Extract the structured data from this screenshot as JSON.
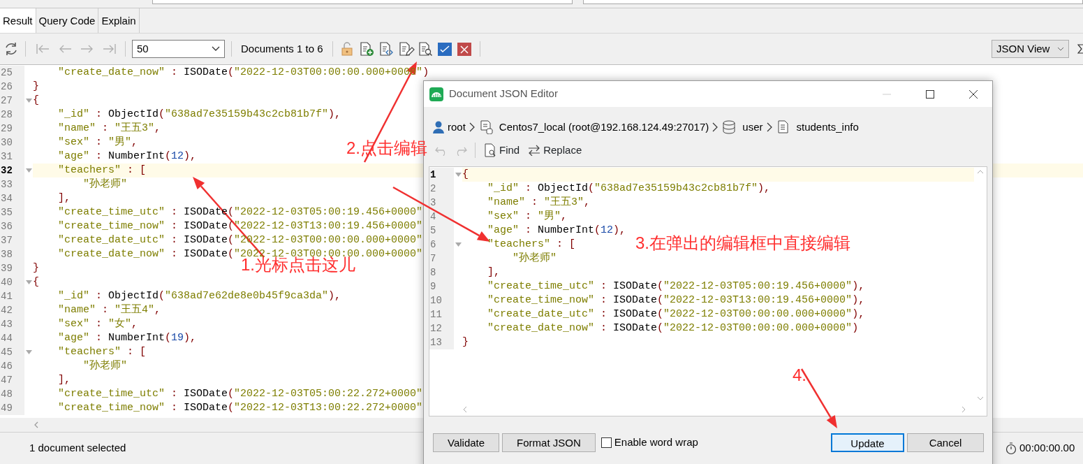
{
  "tabs": [
    {
      "label": "Result",
      "selected": true
    },
    {
      "label": "Query Code",
      "selected": false
    },
    {
      "label": "Explain",
      "selected": false
    }
  ],
  "toolbar": {
    "navigation_disabled": true,
    "page_size": "50",
    "documents_label": "Documents 1 to 6",
    "view_mode": "JSON View"
  },
  "editor": {
    "lines": [
      {
        "no": "25",
        "fold": false,
        "current": false,
        "tokens": [
          {
            "kind": "key",
            "text": "    \"create_date_now\""
          },
          {
            "kind": "punct",
            "text": " : "
          },
          {
            "kind": "func",
            "text": "ISODate"
          },
          {
            "kind": "punct",
            "text": "("
          },
          {
            "kind": "str",
            "text": "\"2022-12-03T00:00:00.000+0000\""
          },
          {
            "kind": "punct",
            "text": ")"
          }
        ]
      },
      {
        "no": "26",
        "fold": false,
        "current": false,
        "tokens": [
          {
            "kind": "punct",
            "text": "}"
          }
        ]
      },
      {
        "no": "27",
        "fold": true,
        "current": false,
        "tokens": [
          {
            "kind": "punct",
            "text": "{"
          }
        ]
      },
      {
        "no": "28",
        "fold": false,
        "current": false,
        "tokens": [
          {
            "kind": "key",
            "text": "    \"_id\""
          },
          {
            "kind": "punct",
            "text": " : "
          },
          {
            "kind": "func",
            "text": "ObjectId"
          },
          {
            "kind": "punct",
            "text": "("
          },
          {
            "kind": "str",
            "text": "\"638ad7e35159b43c2cb81b7f\""
          },
          {
            "kind": "punct",
            "text": "),"
          }
        ]
      },
      {
        "no": "29",
        "fold": false,
        "current": false,
        "tokens": [
          {
            "kind": "key",
            "text": "    \"name\""
          },
          {
            "kind": "punct",
            "text": " : "
          },
          {
            "kind": "str",
            "text": "\"王五3\""
          },
          {
            "kind": "punct",
            "text": ","
          }
        ]
      },
      {
        "no": "30",
        "fold": false,
        "current": false,
        "tokens": [
          {
            "kind": "key",
            "text": "    \"sex\""
          },
          {
            "kind": "punct",
            "text": " : "
          },
          {
            "kind": "str",
            "text": "\"男\""
          },
          {
            "kind": "punct",
            "text": ","
          }
        ]
      },
      {
        "no": "31",
        "fold": false,
        "current": false,
        "tokens": [
          {
            "kind": "key",
            "text": "    \"age\""
          },
          {
            "kind": "punct",
            "text": " : "
          },
          {
            "kind": "func",
            "text": "NumberInt"
          },
          {
            "kind": "punct",
            "text": "("
          },
          {
            "kind": "num",
            "text": "12"
          },
          {
            "kind": "punct",
            "text": "),"
          }
        ]
      },
      {
        "no": "32",
        "fold": true,
        "current": true,
        "tokens": [
          {
            "kind": "key",
            "text": "    \"teachers\""
          },
          {
            "kind": "punct",
            "text": " : ["
          }
        ]
      },
      {
        "no": "33",
        "fold": false,
        "current": false,
        "tokens": [
          {
            "kind": "str",
            "text": "        \"孙老师\""
          }
        ]
      },
      {
        "no": "34",
        "fold": false,
        "current": false,
        "tokens": [
          {
            "kind": "punct",
            "text": "    ],"
          }
        ]
      },
      {
        "no": "35",
        "fold": false,
        "current": false,
        "tokens": [
          {
            "kind": "key",
            "text": "    \"create_time_utc\""
          },
          {
            "kind": "punct",
            "text": " : "
          },
          {
            "kind": "func",
            "text": "ISODate"
          },
          {
            "kind": "punct",
            "text": "("
          },
          {
            "kind": "str",
            "text": "\"2022-12-03T05:00:19.456+0000\""
          }
        ]
      },
      {
        "no": "36",
        "fold": false,
        "current": false,
        "tokens": [
          {
            "kind": "key",
            "text": "    \"create_time_now\""
          },
          {
            "kind": "punct",
            "text": " : "
          },
          {
            "kind": "func",
            "text": "ISODate"
          },
          {
            "kind": "punct",
            "text": "("
          },
          {
            "kind": "str",
            "text": "\"2022-12-03T13:00:19.456+0000\""
          }
        ]
      },
      {
        "no": "37",
        "fold": false,
        "current": false,
        "tokens": [
          {
            "kind": "key",
            "text": "    \"create_date_utc\""
          },
          {
            "kind": "punct",
            "text": " : "
          },
          {
            "kind": "func",
            "text": "ISODate"
          },
          {
            "kind": "punct",
            "text": "("
          },
          {
            "kind": "str",
            "text": "\"2022-12-03T00:00:00.000+0000\""
          }
        ]
      },
      {
        "no": "38",
        "fold": false,
        "current": false,
        "tokens": [
          {
            "kind": "key",
            "text": "    \"create_date_now\""
          },
          {
            "kind": "punct",
            "text": " : "
          },
          {
            "kind": "func",
            "text": "ISODate"
          },
          {
            "kind": "punct",
            "text": "("
          },
          {
            "kind": "str",
            "text": "\"2022-12-03T00:00:00.000+0000\""
          }
        ]
      },
      {
        "no": "39",
        "fold": false,
        "current": false,
        "tokens": [
          {
            "kind": "punct",
            "text": "}"
          }
        ]
      },
      {
        "no": "40",
        "fold": true,
        "current": false,
        "tokens": [
          {
            "kind": "punct",
            "text": "{"
          }
        ]
      },
      {
        "no": "41",
        "fold": false,
        "current": false,
        "tokens": [
          {
            "kind": "key",
            "text": "    \"_id\""
          },
          {
            "kind": "punct",
            "text": " : "
          },
          {
            "kind": "func",
            "text": "ObjectId"
          },
          {
            "kind": "punct",
            "text": "("
          },
          {
            "kind": "str",
            "text": "\"638ad7e62de8e0b45f9ca3da\""
          },
          {
            "kind": "punct",
            "text": "),"
          }
        ]
      },
      {
        "no": "42",
        "fold": false,
        "current": false,
        "tokens": [
          {
            "kind": "key",
            "text": "    \"name\""
          },
          {
            "kind": "punct",
            "text": " : "
          },
          {
            "kind": "str",
            "text": "\"王五4\""
          },
          {
            "kind": "punct",
            "text": ","
          }
        ]
      },
      {
        "no": "43",
        "fold": false,
        "current": false,
        "tokens": [
          {
            "kind": "key",
            "text": "    \"sex\""
          },
          {
            "kind": "punct",
            "text": " : "
          },
          {
            "kind": "str",
            "text": "\"女\""
          },
          {
            "kind": "punct",
            "text": ","
          }
        ]
      },
      {
        "no": "44",
        "fold": false,
        "current": false,
        "tokens": [
          {
            "kind": "key",
            "text": "    \"age\""
          },
          {
            "kind": "punct",
            "text": " : "
          },
          {
            "kind": "func",
            "text": "NumberInt"
          },
          {
            "kind": "punct",
            "text": "("
          },
          {
            "kind": "num",
            "text": "19"
          },
          {
            "kind": "punct",
            "text": "),"
          }
        ]
      },
      {
        "no": "45",
        "fold": true,
        "current": false,
        "tokens": [
          {
            "kind": "key",
            "text": "    \"teachers\""
          },
          {
            "kind": "punct",
            "text": " : ["
          }
        ]
      },
      {
        "no": "46",
        "fold": false,
        "current": false,
        "tokens": [
          {
            "kind": "str",
            "text": "        \"孙老师\""
          }
        ]
      },
      {
        "no": "47",
        "fold": false,
        "current": false,
        "tokens": [
          {
            "kind": "punct",
            "text": "    ],"
          }
        ]
      },
      {
        "no": "48",
        "fold": false,
        "current": false,
        "tokens": [
          {
            "kind": "key",
            "text": "    \"create_time_utc\""
          },
          {
            "kind": "punct",
            "text": " : "
          },
          {
            "kind": "func",
            "text": "ISODate"
          },
          {
            "kind": "punct",
            "text": "("
          },
          {
            "kind": "str",
            "text": "\"2022-12-03T05:00:22.272+0000\""
          }
        ]
      },
      {
        "no": "49",
        "fold": false,
        "current": false,
        "tokens": [
          {
            "kind": "key",
            "text": "    \"create_time_now\""
          },
          {
            "kind": "punct",
            "text": " : "
          },
          {
            "kind": "func",
            "text": "ISODate"
          },
          {
            "kind": "punct",
            "text": "("
          },
          {
            "kind": "str",
            "text": "\"2022-12-03T13:00:22.272+0000\""
          }
        ]
      }
    ]
  },
  "status_bar": {
    "text": "1 document selected",
    "timer": "00:00:00.00"
  },
  "dialog": {
    "title": "Document JSON Editor",
    "breadcrumb": [
      {
        "kind": "user",
        "label": "root"
      },
      {
        "kind": "connection",
        "label": "Centos7_local (root@192.168.124.49:27017)"
      },
      {
        "kind": "database",
        "label": "user"
      },
      {
        "kind": "collection",
        "label": "students_info"
      }
    ],
    "undo_disabled": true,
    "find": "Find",
    "replace": "Replace",
    "lines": [
      {
        "no": "1",
        "fold": true,
        "current": true,
        "tokens": [
          {
            "kind": "punct",
            "text": "{"
          }
        ]
      },
      {
        "no": "2",
        "fold": false,
        "current": false,
        "tokens": [
          {
            "kind": "key",
            "text": "    \"_id\""
          },
          {
            "kind": "punct",
            "text": " : "
          },
          {
            "kind": "func",
            "text": "ObjectId"
          },
          {
            "kind": "punct",
            "text": "("
          },
          {
            "kind": "str",
            "text": "\"638ad7e35159b43c2cb81b7f\""
          },
          {
            "kind": "punct",
            "text": "),"
          }
        ]
      },
      {
        "no": "3",
        "fold": false,
        "current": false,
        "tokens": [
          {
            "kind": "key",
            "text": "    \"name\""
          },
          {
            "kind": "punct",
            "text": " : "
          },
          {
            "kind": "str",
            "text": "\"王五3\""
          },
          {
            "kind": "punct",
            "text": ","
          }
        ]
      },
      {
        "no": "4",
        "fold": false,
        "current": false,
        "tokens": [
          {
            "kind": "key",
            "text": "    \"sex\""
          },
          {
            "kind": "punct",
            "text": " : "
          },
          {
            "kind": "str",
            "text": "\"男\""
          },
          {
            "kind": "punct",
            "text": ","
          }
        ]
      },
      {
        "no": "5",
        "fold": false,
        "current": false,
        "tokens": [
          {
            "kind": "key",
            "text": "    \"age\""
          },
          {
            "kind": "punct",
            "text": " : "
          },
          {
            "kind": "func",
            "text": "NumberInt"
          },
          {
            "kind": "punct",
            "text": "("
          },
          {
            "kind": "num",
            "text": "12"
          },
          {
            "kind": "punct",
            "text": "),"
          }
        ]
      },
      {
        "no": "6",
        "fold": true,
        "current": false,
        "tokens": [
          {
            "kind": "key",
            "text": "    \"teachers\""
          },
          {
            "kind": "punct",
            "text": " : ["
          }
        ]
      },
      {
        "no": "7",
        "fold": false,
        "current": false,
        "tokens": [
          {
            "kind": "str",
            "text": "        \"孙老师\""
          }
        ]
      },
      {
        "no": "8",
        "fold": false,
        "current": false,
        "tokens": [
          {
            "kind": "punct",
            "text": "    ],"
          }
        ]
      },
      {
        "no": "9",
        "fold": false,
        "current": false,
        "tokens": [
          {
            "kind": "key",
            "text": "    \"create_time_utc\""
          },
          {
            "kind": "punct",
            "text": " : "
          },
          {
            "kind": "func",
            "text": "ISODate"
          },
          {
            "kind": "punct",
            "text": "("
          },
          {
            "kind": "str",
            "text": "\"2022-12-03T05:00:19.456+0000\""
          },
          {
            "kind": "punct",
            "text": "),"
          }
        ]
      },
      {
        "no": "10",
        "fold": false,
        "current": false,
        "tokens": [
          {
            "kind": "key",
            "text": "    \"create_time_now\""
          },
          {
            "kind": "punct",
            "text": " : "
          },
          {
            "kind": "func",
            "text": "ISODate"
          },
          {
            "kind": "punct",
            "text": "("
          },
          {
            "kind": "str",
            "text": "\"2022-12-03T13:00:19.456+0000\""
          },
          {
            "kind": "punct",
            "text": "),"
          }
        ]
      },
      {
        "no": "11",
        "fold": false,
        "current": false,
        "tokens": [
          {
            "kind": "key",
            "text": "    \"create_date_utc\""
          },
          {
            "kind": "punct",
            "text": " : "
          },
          {
            "kind": "func",
            "text": "ISODate"
          },
          {
            "kind": "punct",
            "text": "("
          },
          {
            "kind": "str",
            "text": "\"2022-12-03T00:00:00.000+0000\""
          },
          {
            "kind": "punct",
            "text": "),"
          }
        ]
      },
      {
        "no": "12",
        "fold": false,
        "current": false,
        "tokens": [
          {
            "kind": "key",
            "text": "    \"create_date_now\""
          },
          {
            "kind": "punct",
            "text": " : "
          },
          {
            "kind": "func",
            "text": "ISODate"
          },
          {
            "kind": "punct",
            "text": "("
          },
          {
            "kind": "str",
            "text": "\"2022-12-03T00:00:00.000+0000\""
          },
          {
            "kind": "punct",
            "text": ")"
          }
        ]
      },
      {
        "no": "13",
        "fold": false,
        "current": false,
        "tokens": [
          {
            "kind": "punct",
            "text": "}"
          }
        ]
      }
    ],
    "buttons": [
      {
        "label": "Validate",
        "default": false
      },
      {
        "label": "Format JSON",
        "default": false
      }
    ],
    "word_wrap": {
      "label": "Enable word wrap",
      "checked": false
    },
    "actions": [
      {
        "label": "Update",
        "default": true
      },
      {
        "label": "Cancel",
        "default": false
      }
    ]
  },
  "annotations": [
    {
      "text": "1.光标点击这儿"
    },
    {
      "text": "2.点击编辑"
    },
    {
      "text": "3.在弹出的编辑框中直接编辑"
    },
    {
      "text": "4."
    }
  ]
}
